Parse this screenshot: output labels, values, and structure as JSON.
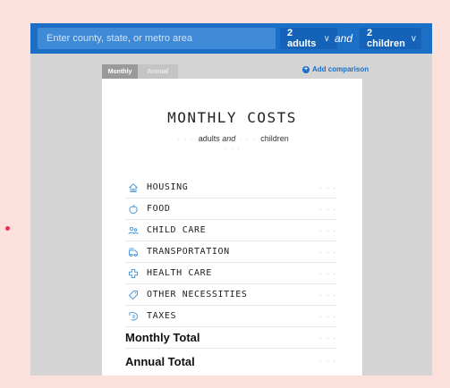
{
  "search": {
    "placeholder": "Enter county, state, or metro area"
  },
  "family": {
    "adults": "2 adults",
    "and": "and",
    "children": "2 children"
  },
  "tabs": {
    "monthly": "Monthly",
    "annual": "Annual"
  },
  "add_comparison": "Add comparison",
  "card": {
    "title": "MONTHLY COSTS",
    "placeholder": "· · ·",
    "adults_word": "adults",
    "and_word": "and",
    "children_word": "children"
  },
  "costs": [
    {
      "label": "HOUSING",
      "icon": "house-icon",
      "value": "· · ·"
    },
    {
      "label": "FOOD",
      "icon": "apple-icon",
      "value": "· · ·"
    },
    {
      "label": "CHILD CARE",
      "icon": "people-icon",
      "value": "· · ·"
    },
    {
      "label": "TRANSPORTATION",
      "icon": "car-icon",
      "value": "· · ·"
    },
    {
      "label": "HEALTH CARE",
      "icon": "health-cross-icon",
      "value": "· · ·"
    },
    {
      "label": "OTHER NECESSITIES",
      "icon": "tag-icon",
      "value": "· · ·"
    },
    {
      "label": "TAXES",
      "icon": "receipt-icon",
      "value": "· · ·"
    }
  ],
  "totals": [
    {
      "label": "Monthly Total",
      "value": "· · ·"
    },
    {
      "label": "Annual Total",
      "value": "· · ·"
    }
  ],
  "colors": {
    "brand_blue": "#1b6fc7",
    "background": "#fce0dc",
    "icon_blue": "#4f9bd9"
  }
}
